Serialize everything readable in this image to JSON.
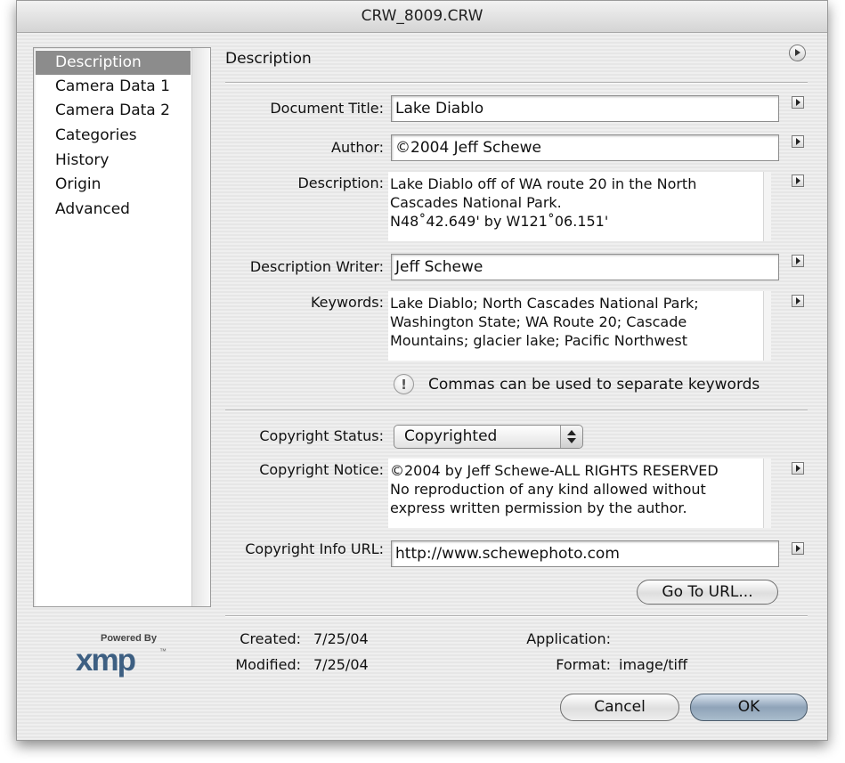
{
  "window": {
    "title": "CRW_8009.CRW"
  },
  "sidebar": {
    "items": [
      {
        "label": "Description",
        "selected": true
      },
      {
        "label": "Camera Data 1"
      },
      {
        "label": "Camera Data 2"
      },
      {
        "label": "Categories"
      },
      {
        "label": "History"
      },
      {
        "label": "Origin"
      },
      {
        "label": "Advanced"
      }
    ]
  },
  "panel": {
    "heading": "Description"
  },
  "fields": {
    "document_title": {
      "label": "Document Title:",
      "value": "Lake Diablo"
    },
    "author": {
      "label": "Author:",
      "value": "©2004 Jeff Schewe"
    },
    "description": {
      "label": "Description:",
      "lines": [
        "Lake Diablo off of WA route 20 in the North",
        "Cascades National Park.",
        "N48˚42.649' by W121˚06.151'"
      ]
    },
    "description_writer": {
      "label": "Description Writer:",
      "value": "Jeff Schewe"
    },
    "keywords": {
      "label": "Keywords:",
      "lines": [
        "Lake Diablo; North Cascades National Park;",
        "Washington State; WA Route 20; Cascade",
        "Mountains; glacier lake; Pacific Northwest"
      ]
    },
    "keywords_hint": "Commas can be used to separate keywords",
    "copyright_status": {
      "label": "Copyright Status:",
      "value": "Copyrighted"
    },
    "copyright_notice": {
      "label": "Copyright Notice:",
      "lines": [
        "©2004 by Jeff Schewe-ALL RIGHTS RESERVED",
        "No reproduction of any kind allowed without",
        "express written permission by the author."
      ]
    },
    "copyright_url": {
      "label": "Copyright Info URL:",
      "value": "http://www.schewephoto.com"
    }
  },
  "buttons": {
    "go_to_url": "Go To URL...",
    "cancel": "Cancel",
    "ok": "OK"
  },
  "footer": {
    "created_label": "Created:",
    "created_value": "7/25/04",
    "modified_label": "Modified:",
    "modified_value": "7/25/04",
    "application_label": "Application:",
    "application_value": "",
    "format_label": "Format:",
    "format_value": "image/tiff"
  },
  "branding": {
    "powered_by": "Powered By",
    "logo": "xmp",
    "tm": "™"
  },
  "icons": {
    "panel_menu": "circle-arrow-icon",
    "field_menu": "triangle-menu-icon",
    "hint": "exclamation-icon",
    "popup": "up-down-arrows-icon"
  },
  "colors": {
    "selection": "#8c8c8c",
    "default_button": "#8fa3b8",
    "logo": "#3d5f82"
  }
}
